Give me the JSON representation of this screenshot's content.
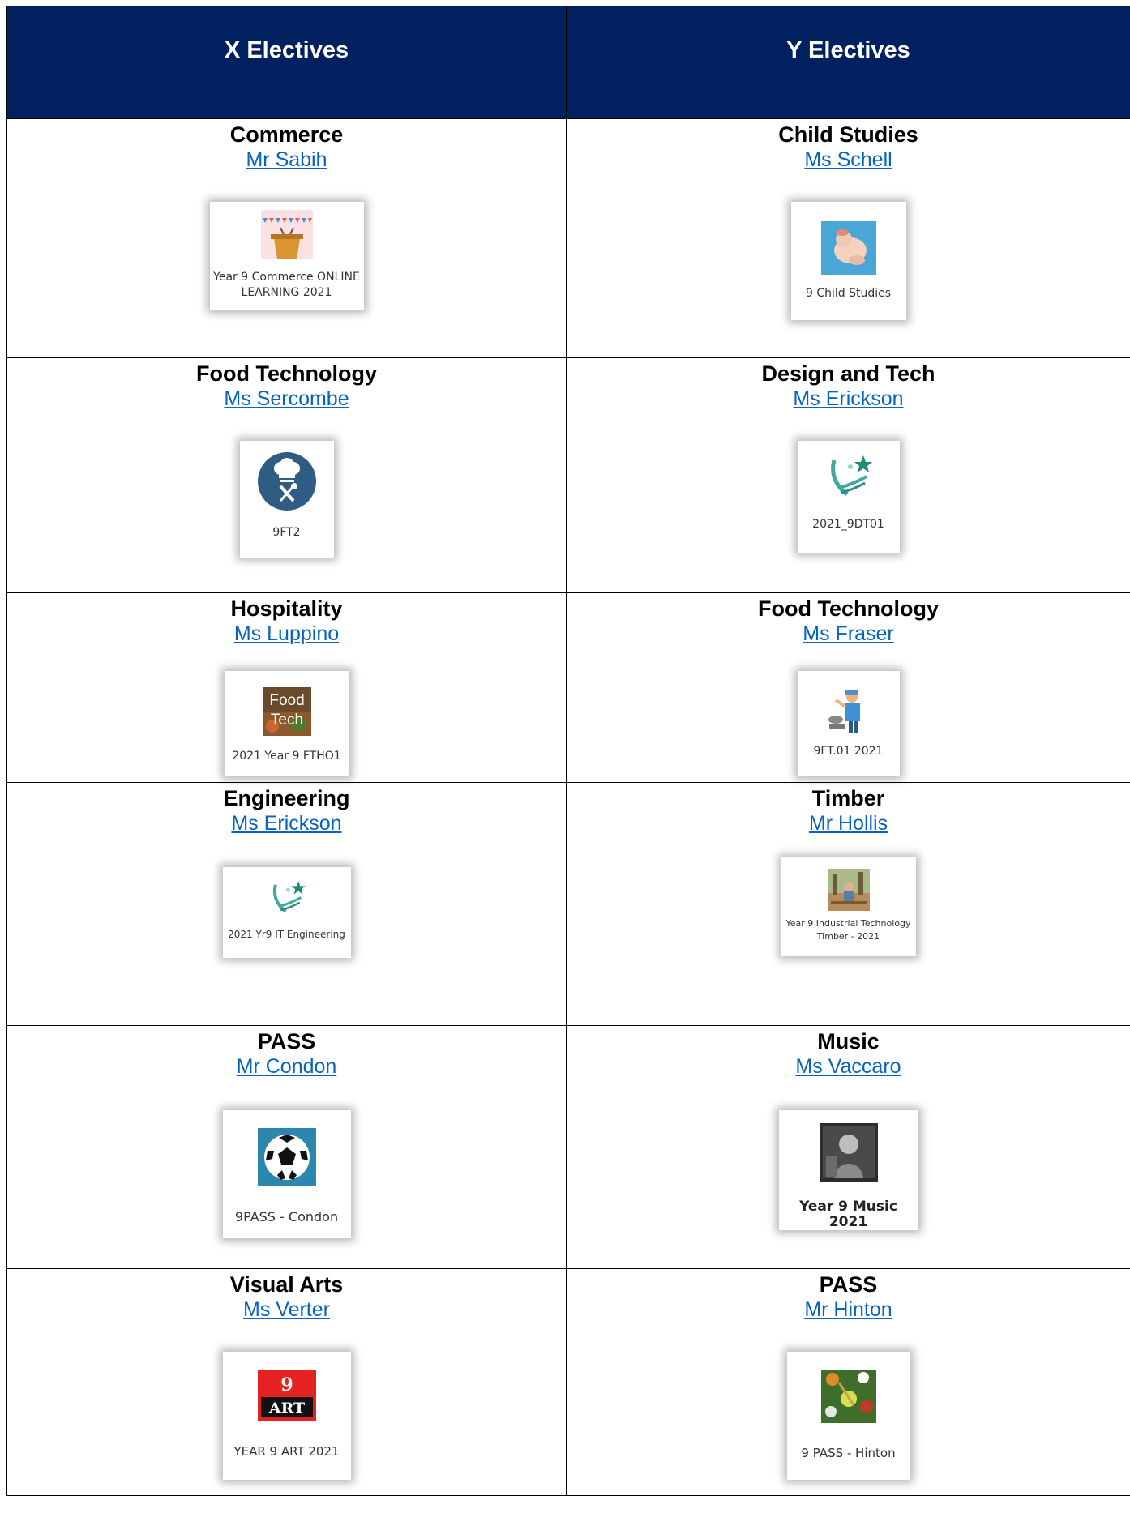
{
  "headers": {
    "x": "X Electives",
    "y": "Y Electives"
  },
  "rows": [
    {
      "x": {
        "subject": "Commerce",
        "teacher": "Mr Sabih",
        "card": "Year 9 Commerce ONLINE LEARNING 2021",
        "icon": "podium-icon"
      },
      "y": {
        "subject": "Child Studies",
        "teacher": "Ms Schell",
        "card": "9 Child Studies",
        "icon": "baby-photo-icon"
      }
    },
    {
      "x": {
        "subject": "Food Technology",
        "teacher": "Ms Sercombe",
        "card": "9FT2",
        "icon": "chef-hat-utensils-icon"
      },
      "y": {
        "subject": "Design and Tech",
        "teacher": "Ms Erickson",
        "card": "2021_9DT01",
        "icon": "school-crest-icon"
      }
    },
    {
      "x": {
        "subject": "Hospitality",
        "teacher": "Ms Luppino",
        "card": "2021 Year 9 FTHO1",
        "icon": "food-tech-photo-icon",
        "icon_text": [
          "Food",
          "Tech"
        ]
      },
      "y": {
        "subject": "Food Technology",
        "teacher": "Ms Fraser",
        "card": "9FT.01 2021",
        "icon": "cook-figure-icon"
      }
    },
    {
      "x": {
        "subject": "Engineering",
        "teacher": "Ms Erickson",
        "card": "2021 Yr9 IT Engineering",
        "icon": "school-crest-icon"
      },
      "y": {
        "subject": "Timber",
        "teacher": "Mr Hollis",
        "card": "Year 9 Industrial Technology Timber - 2021",
        "icon": "workshop-photo-icon"
      }
    },
    {
      "x": {
        "subject": "PASS",
        "teacher": "Mr Condon",
        "card": "9PASS - Condon",
        "icon": "soccer-ball-icon"
      },
      "y": {
        "subject": "Music",
        "teacher": "Ms Vaccaro",
        "card": "Year 9 Music 2021",
        "icon": "composer-portrait-icon"
      }
    },
    {
      "x": {
        "subject": "Visual Arts",
        "teacher": "Ms Verter",
        "card": "YEAR 9 ART 2021",
        "icon": "nine-art-badge-icon",
        "icon_text": [
          "9",
          "ART"
        ]
      },
      "y": {
        "subject": "PASS",
        "teacher": "Mr Hinton",
        "card": "9 PASS - Hinton",
        "icon": "sports-balls-photo-icon"
      }
    }
  ],
  "colors": {
    "header_bg": "#002060",
    "link": "#0563c1",
    "border": "#000000"
  }
}
